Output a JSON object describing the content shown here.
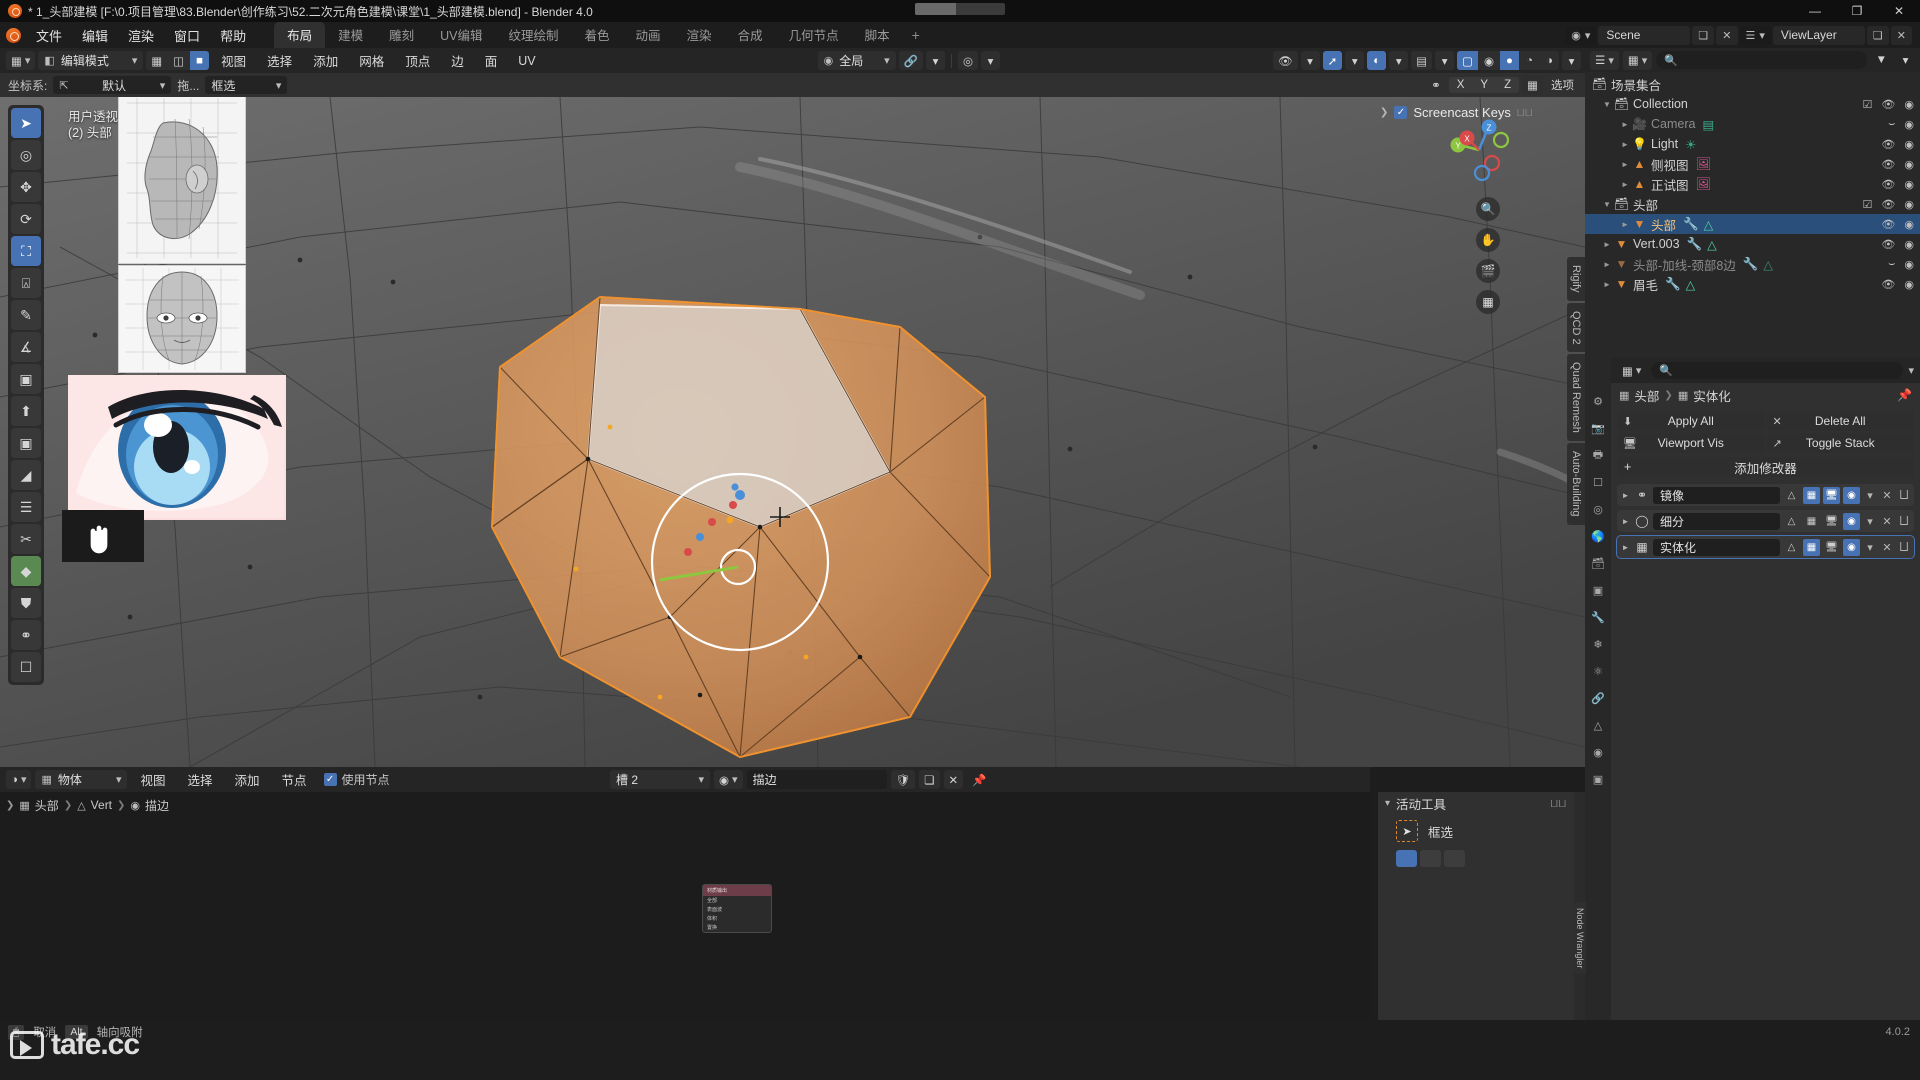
{
  "window": {
    "title": "* 1_头部建模 [F:\\0.项目管理\\83.Blender\\创作练习\\52.二次元角色建模\\课堂\\1_头部建模.blend] - Blender 4.0",
    "minimize": "—",
    "maximize": "❐",
    "close": "✕"
  },
  "topbar": {
    "menus": [
      "文件",
      "编辑",
      "渲染",
      "窗口",
      "帮助"
    ],
    "workspaces": [
      "布局",
      "建模",
      "雕刻",
      "UV编辑",
      "纹理绘制",
      "着色",
      "动画",
      "渲染",
      "合成",
      "几何节点",
      "脚本"
    ],
    "active_workspace": "布局",
    "add_workspace": "+",
    "scene_name": "Scene",
    "viewlayer_name": "ViewLayer"
  },
  "viewport_header": {
    "editor_type_icon": "editor-type",
    "mode": "编辑模式",
    "select_modes": [
      "vertex",
      "edge",
      "face"
    ],
    "active_select_mode": "face",
    "menus": [
      "视图",
      "选择",
      "添加",
      "网格",
      "顶点",
      "边",
      "面",
      "UV"
    ],
    "snap_dropdown": "全局",
    "overlay_icons": [
      "magnet-icon",
      "proportional-edit-icon",
      "xray-icon",
      "shading-solid-icon"
    ]
  },
  "viewport_header2": {
    "transform_label": "坐标系:",
    "transform_value": "默认",
    "drag_label": "拖...",
    "drag_value": "框选",
    "mirror_axes": [
      "X",
      "Y",
      "Z"
    ],
    "options_label": "选项"
  },
  "viewport": {
    "view_name": "用户透视",
    "object_info": "(2) 头部",
    "screencast_keys": "Screencast Keys",
    "screencast_enabled": true,
    "gizmo_axes": [
      "X",
      "Y",
      "Z"
    ],
    "nav_buttons": [
      "zoom-icon",
      "pan-icon",
      "camera-icon",
      "ortho-icon"
    ],
    "side_tabs": [
      "Rigify",
      "QCD 2",
      "Quad Remesh",
      "Auto-Building"
    ],
    "tools": [
      {
        "name": "tweak-tool",
        "glyph": "➤"
      },
      {
        "name": "cursor-tool",
        "glyph": "⌖"
      },
      {
        "name": "move-tool",
        "glyph": "✥"
      },
      {
        "name": "rotate-tool",
        "glyph": "⟳"
      },
      {
        "name": "scale-tool",
        "glyph": "⧉",
        "active": true
      },
      {
        "name": "transform-tool",
        "glyph": "⬚"
      },
      {
        "name": "annotate-tool",
        "glyph": "✎"
      },
      {
        "name": "measure-tool",
        "glyph": "∠"
      },
      {
        "name": "add-cube-tool",
        "glyph": "⬛"
      },
      {
        "name": "extrude-tool",
        "glyph": "⬆"
      },
      {
        "name": "inset-tool",
        "glyph": "▣"
      },
      {
        "name": "bevel-tool",
        "glyph": "◢"
      },
      {
        "name": "loopcut-tool",
        "glyph": "≡"
      },
      {
        "name": "knife-tool",
        "glyph": "✂"
      },
      {
        "name": "poly-build-tool",
        "glyph": "◆",
        "green": true
      },
      {
        "name": "spin-tool",
        "glyph": "⊚"
      },
      {
        "name": "smooth-tool",
        "glyph": "●"
      },
      {
        "name": "shrink-fatten-tool",
        "glyph": "⬜"
      }
    ]
  },
  "shader_editor": {
    "editor_icon": "shading-icon",
    "shader_type": "物体",
    "menus": [
      "视图",
      "选择",
      "添加",
      "节点"
    ],
    "use_nodes_label": "使用节点",
    "use_nodes_checked": true,
    "slot": "槽 2",
    "material_name": "描边",
    "breadcrumb": [
      "头部",
      "Vert",
      "描边"
    ],
    "node": {
      "title": "材质输出",
      "rows": [
        "全部",
        "表面波",
        "体积",
        "置换"
      ]
    }
  },
  "outliner": {
    "display_mode_icon": "outliner-icon",
    "filter_icon": "funnel-icon",
    "search_placeholder": "",
    "root": "场景集合",
    "rows": [
      {
        "name": "Collection",
        "indent": 1,
        "icon": "collection-icon",
        "expanded": true,
        "checkbox": true,
        "eye": true,
        "camera": true,
        "dim": false
      },
      {
        "name": "Camera",
        "indent": 2,
        "icon": "camera-icon",
        "expanded": false,
        "eye": false,
        "camera": true,
        "dim": true
      },
      {
        "name": "Light",
        "indent": 2,
        "icon": "light-icon",
        "expanded": false,
        "eye": true,
        "camera": true,
        "dim": false
      },
      {
        "name": "侧视图",
        "indent": 2,
        "icon": "image-icon",
        "expanded": false,
        "eye": true,
        "camera": true,
        "dim": false
      },
      {
        "name": "正试图",
        "indent": 2,
        "icon": "image-icon",
        "expanded": false,
        "eye": true,
        "camera": true,
        "dim": false
      },
      {
        "name": "头部",
        "indent": 1,
        "icon": "collection-icon",
        "expanded": true,
        "checkbox": true,
        "eye": true,
        "camera": true,
        "dim": false
      },
      {
        "name": "头部",
        "indent": 2,
        "icon": "mesh-icon",
        "expanded": false,
        "eye": true,
        "camera": true,
        "selected": true,
        "dim": false
      },
      {
        "name": "Vert.003",
        "indent": 1,
        "icon": "mesh-icon",
        "expanded": false,
        "eye": true,
        "camera": true,
        "dim": false
      },
      {
        "name": "头部-加线-颈部8边",
        "indent": 1,
        "icon": "mesh-icon",
        "expanded": false,
        "eye": false,
        "camera": true,
        "dim": true
      },
      {
        "name": "眉毛",
        "indent": 1,
        "icon": "mesh-icon",
        "expanded": false,
        "eye": true,
        "camera": true,
        "dim": false
      }
    ]
  },
  "properties": {
    "search_placeholder": "",
    "breadcrumb_object": "头部",
    "breadcrumb_modifier": "实体化",
    "pin_icon": "pin-icon",
    "buttons": [
      {
        "label": "Apply All",
        "icon": "download-icon"
      },
      {
        "label": "Delete All",
        "icon": "x-icon"
      },
      {
        "label": "Viewport Vis",
        "icon": "monitor-icon"
      },
      {
        "label": "Toggle Stack",
        "icon": "expand-icon"
      }
    ],
    "add_modifier": "添加修改器",
    "modifiers": [
      {
        "name": "镜像",
        "icon": "mirror-icon",
        "toggles": [
          false,
          true,
          true,
          true
        ],
        "selected": false
      },
      {
        "name": "细分",
        "icon": "subsurf-icon",
        "toggles": [
          false,
          false,
          false,
          true
        ],
        "selected": false
      },
      {
        "name": "实体化",
        "icon": "solidify-icon",
        "toggles": [
          false,
          true,
          false,
          true
        ],
        "selected": true
      }
    ],
    "tabs": [
      "tool-icon",
      "render-icon",
      "output-icon",
      "viewlayer-icon",
      "scene-icon",
      "world-icon",
      "collection-icon",
      "object-icon",
      "modifier-icon",
      "particles-icon",
      "physics-icon",
      "constraint-icon",
      "data-icon",
      "material-icon",
      "texture-icon"
    ],
    "active_tab_index": 8
  },
  "active_tool_panel": {
    "title": "活动工具",
    "tool_name": "框选",
    "modes": [
      "set",
      "extend",
      "subtract"
    ],
    "active_mode_index": 0,
    "side_tabs": [
      "Node Wrangler"
    ]
  },
  "statusbar": {
    "items": [
      {
        "key": "mouse",
        "label": "取消"
      },
      {
        "key": "Alt",
        "label": "轴向吸附"
      }
    ],
    "version": "4.0.2"
  },
  "watermark": {
    "text": "tafe.cc"
  },
  "colors": {
    "accent_blue": "#4772b3",
    "header_dark": "#252525",
    "panel": "#303030",
    "outliner_bg": "#282828",
    "selected_row": "#2a4f7a",
    "mesh_orange": "#e08a2e",
    "titlebar": "#0f0f0f"
  }
}
